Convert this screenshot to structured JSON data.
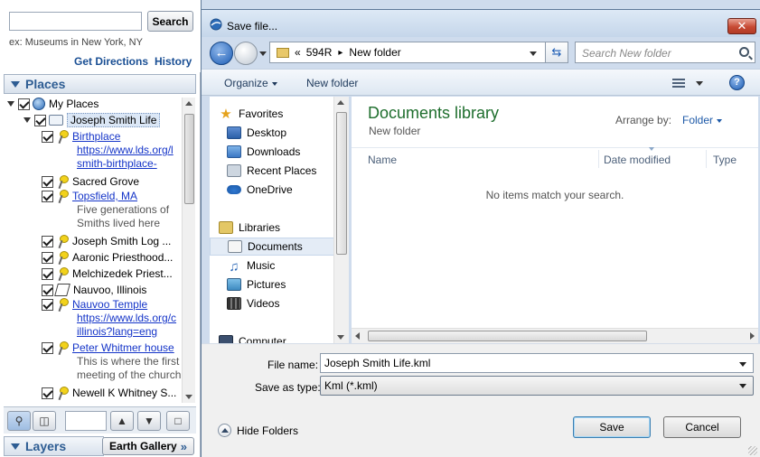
{
  "left_panel": {
    "search": {
      "value": "",
      "button_label": "Search",
      "example": "ex: Museums in New York, NY"
    },
    "get_directions": "Get Directions",
    "history": "History",
    "places_title": "Places",
    "layers_title": "Layers",
    "earth_gallery": "Earth Gallery",
    "earth_gallery_arrow": "»",
    "tree": {
      "my_places": "My Places",
      "folder": "Joseph Smith Life",
      "rows": [
        {
          "label": "Birthplace",
          "kind": "link"
        },
        {
          "label": "https://www.lds.org/l",
          "kind": "link"
        },
        {
          "label": "smith-birthplace-",
          "kind": "link"
        },
        {
          "label": "Sacred Grove",
          "kind": "text"
        },
        {
          "label": "Topsfield, MA",
          "kind": "link"
        },
        {
          "label": "Five generations of",
          "kind": "desc"
        },
        {
          "label": "Smiths lived here",
          "kind": "desc"
        },
        {
          "label": "Joseph Smith Log ...",
          "kind": "text"
        },
        {
          "label": "Aaronic Priesthood...",
          "kind": "text"
        },
        {
          "label": "Melchizedek Priest...",
          "kind": "text"
        },
        {
          "label": "Nauvoo, Illinois",
          "kind": "text"
        },
        {
          "label": "Nauvoo Temple",
          "kind": "link"
        },
        {
          "label": "https://www.lds.org/c",
          "kind": "link"
        },
        {
          "label": "illinois?lang=eng",
          "kind": "link"
        },
        {
          "label": "Peter Whitmer house",
          "kind": "link"
        },
        {
          "label": "This is where the first",
          "kind": "desc"
        },
        {
          "label": "meeting of the church",
          "kind": "desc"
        },
        {
          "label": "Newell K Whitney S...",
          "kind": "text"
        }
      ]
    },
    "toolbar_up": "▲",
    "toolbar_down": "▼"
  },
  "dialog": {
    "title": "Save file...",
    "close": "✕",
    "back": "←",
    "address": {
      "prefix": "«",
      "segment1": "594R",
      "sep": "▸",
      "segment2": "New folder"
    },
    "refresh": "⇆",
    "search_placeholder": "Search New folder",
    "organize": "Organize",
    "new_folder": "New folder",
    "help": "?",
    "nav": {
      "favorites": "Favorites",
      "desktop": "Desktop",
      "downloads": "Downloads",
      "recent": "Recent Places",
      "onedrive": "OneDrive",
      "libraries": "Libraries",
      "documents": "Documents",
      "music": "Music",
      "pictures": "Pictures",
      "videos": "Videos",
      "computer": "Computer"
    },
    "content": {
      "title": "Documents library",
      "subtitle": "New folder",
      "arrange_label": "Arrange by:",
      "arrange_value": "Folder",
      "columns": [
        "Name",
        "Date modified",
        "Type"
      ],
      "empty": "No items match your search."
    },
    "file_name_label": "File name:",
    "file_name_value": "Joseph Smith Life.kml",
    "save_type_label": "Save as type:",
    "save_type_value": "Kml (*.kml)",
    "hide_folders": "Hide Folders",
    "save": "Save",
    "cancel": "Cancel"
  },
  "colors": {
    "accent": "#2e5d93",
    "link": "#1434c8",
    "library_title": "#1e6e2d",
    "close": "#c74a34"
  }
}
